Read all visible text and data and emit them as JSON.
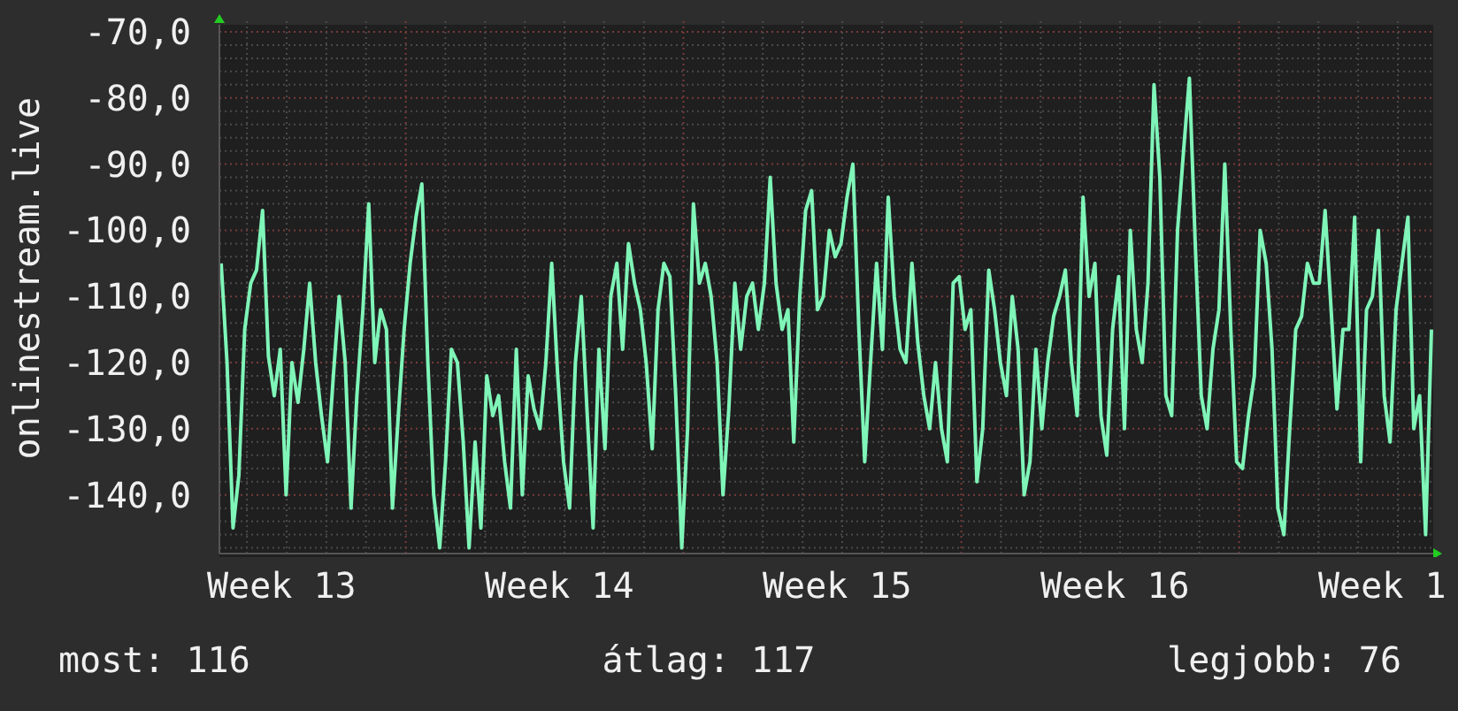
{
  "chart": {
    "chart_data": {
      "type": "line",
      "grid": true,
      "ylabel": "onlinestream.live",
      "ylim": [
        -149.4,
        -69.2
      ],
      "yticks": [
        {
          "value": -70,
          "label": "-70,0"
        },
        {
          "value": -80,
          "label": "-80,0"
        },
        {
          "value": -90,
          "label": "-90,0"
        },
        {
          "value": -100,
          "label": "-100,0"
        },
        {
          "value": -110,
          "label": "-110,0"
        },
        {
          "value": -120,
          "label": "-120,0"
        },
        {
          "value": -130,
          "label": "-130,0"
        },
        {
          "value": -140,
          "label": "-140,0"
        }
      ],
      "series": [
        {
          "color": "#7ff5b8",
          "values": [
            -105,
            -120,
            -145,
            -137,
            -115,
            -108,
            -106,
            -97,
            -119,
            -125,
            -118,
            -140,
            -120,
            -126,
            -118,
            -108,
            -120,
            -128,
            -135,
            -122,
            -110,
            -120,
            -142,
            -125,
            -112,
            -96,
            -120,
            -112,
            -115,
            -142,
            -128,
            -115,
            -105,
            -98,
            -93,
            -120,
            -140,
            -148,
            -135,
            -118,
            -120,
            -132,
            -148,
            -132,
            -145,
            -122,
            -128,
            -125,
            -135,
            -142,
            -118,
            -140,
            -122,
            -127,
            -130,
            -120,
            -105,
            -122,
            -135,
            -142,
            -120,
            -110,
            -128,
            -145,
            -118,
            -133,
            -110,
            -105,
            -118,
            -102,
            -108,
            -112,
            -120,
            -133,
            -112,
            -105,
            -107,
            -125,
            -148,
            -130,
            -96,
            -108,
            -105,
            -110,
            -120,
            -140,
            -127,
            -108,
            -118,
            -110,
            -108,
            -115,
            -108,
            -92,
            -108,
            -115,
            -112,
            -132,
            -110,
            -97,
            -94,
            -112,
            -110,
            -100,
            -104,
            -102,
            -95,
            -90,
            -115,
            -135,
            -120,
            -105,
            -118,
            -95,
            -110,
            -118,
            -120,
            -105,
            -117,
            -125,
            -130,
            -120,
            -130,
            -135,
            -108,
            -107,
            -115,
            -112,
            -138,
            -130,
            -106,
            -112,
            -120,
            -125,
            -110,
            -118,
            -140,
            -135,
            -118,
            -130,
            -120,
            -113,
            -110,
            -106,
            -120,
            -128,
            -95,
            -110,
            -105,
            -128,
            -134,
            -115,
            -107,
            -130,
            -100,
            -115,
            -120,
            -108,
            -78,
            -92,
            -125,
            -128,
            -100,
            -88,
            -77,
            -102,
            -125,
            -130,
            -118,
            -112,
            -90,
            -115,
            -135,
            -136,
            -128,
            -122,
            -100,
            -105,
            -118,
            -142,
            -146,
            -130,
            -115,
            -113,
            -105,
            -108,
            -108,
            -97,
            -112,
            -127,
            -115,
            -115,
            -98,
            -135,
            -112,
            -110,
            -100,
            -125,
            -132,
            -112,
            -105,
            -98,
            -130,
            -125,
            -146,
            -115
          ]
        }
      ]
    }
  },
  "week_labels": [
    "Week 13",
    "Week 14",
    "Week 15",
    "Week 16",
    "Week 1"
  ],
  "stats": [
    "most: 116",
    "átlag: 117",
    "legjobb: 76"
  ]
}
